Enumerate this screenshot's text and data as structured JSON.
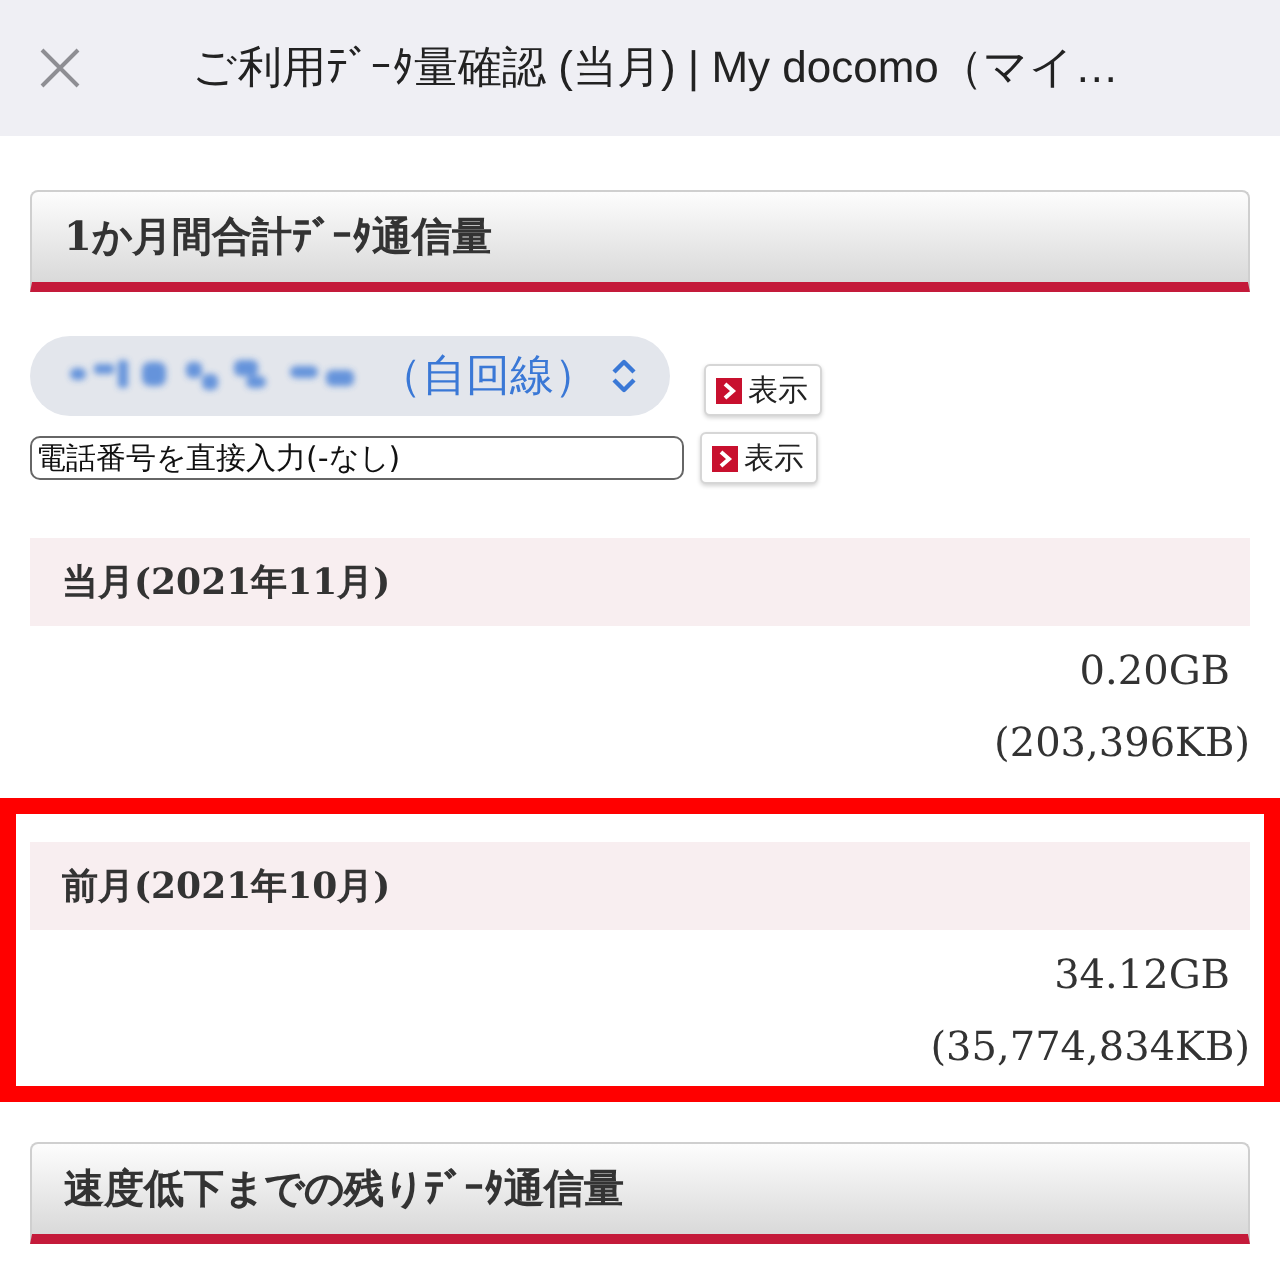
{
  "header": {
    "title": "ご利用ﾃﾞｰﾀ量確認 (当月) | My docomo（マイ…"
  },
  "usage_section": {
    "title": "1か月間合計ﾃﾞｰﾀ通信量",
    "line_select": {
      "redacted": true,
      "label": "（自回線）",
      "button": "表示"
    },
    "phone_input": {
      "value": "電話番号を直接入力(-なし)",
      "button": "表示"
    },
    "months": [
      {
        "label": "当月(2021年11月)",
        "gb": "0.20GB",
        "kb": "(203,396KB)",
        "highlighted": false
      },
      {
        "label": "前月(2021年10月)",
        "gb": "34.12GB",
        "kb": "(35,774,834KB)",
        "highlighted": true
      }
    ]
  },
  "remaining_section": {
    "title": "速度低下までの残りﾃﾞｰﾀ通信量"
  }
}
